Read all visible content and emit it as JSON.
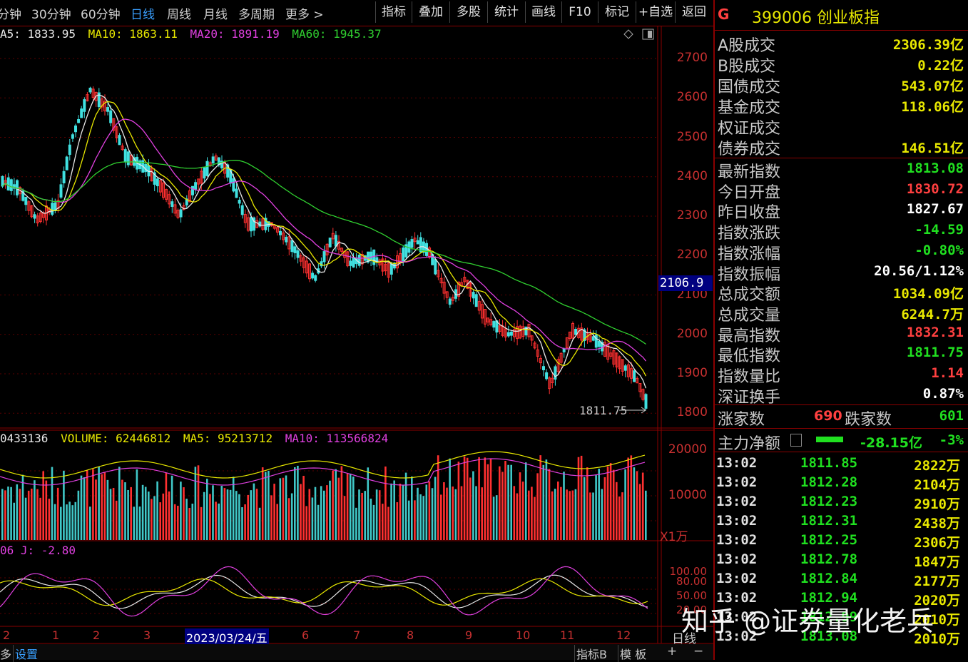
{
  "toolbar": {
    "periods": [
      "分钟",
      "30分钟",
      "60分钟",
      "日线",
      "周线",
      "月线",
      "多周期",
      "更多 >"
    ],
    "active_period": "日线",
    "buttons": [
      "指标",
      "叠加",
      "多股",
      "统计",
      "画线",
      "F10",
      "标记",
      "+自选",
      "返回"
    ]
  },
  "main_chart": {
    "ma_legend": [
      {
        "label": "A5: 1833.95",
        "color": "#e8e8e8"
      },
      {
        "label": "MA10: 1863.11",
        "color": "#e8e800"
      },
      {
        "label": "MA20: 1891.19",
        "color": "#e040e0"
      },
      {
        "label": "MA60: 1945.37",
        "color": "#30d030"
      }
    ],
    "y_ticks": [
      "2700",
      "2600",
      "2500",
      "2400",
      "2300",
      "2200",
      "2100",
      "2000",
      "1900",
      "1800"
    ],
    "cursor_price": "2106.9",
    "low_label": "1811.75"
  },
  "volume_panel": {
    "legend": [
      {
        "label": "0433136",
        "color": "#e8e8e8"
      },
      {
        "label": "VOLUME: 62446812",
        "color": "#e8e800"
      },
      {
        "label": "MA5: 95213712",
        "color": "#e8e800"
      },
      {
        "label": "MA10: 113566824",
        "color": "#e040e0"
      }
    ],
    "y_ticks": [
      "20000",
      "10000"
    ],
    "unit": "X1万"
  },
  "kdj_panel": {
    "legend": [
      {
        "label": "06  J: -2.80",
        "color": "#e040e0"
      }
    ],
    "y_ticks": [
      "100.00",
      "80.00",
      "50.00",
      "20.00"
    ]
  },
  "x_axis": {
    "labels": [
      "2",
      "1",
      "2",
      "3",
      "2023/03/24/五",
      "6",
      "7",
      "8",
      "9",
      "10",
      "11",
      "12"
    ],
    "right_label": "日线"
  },
  "bottom_bar": {
    "left_items": [
      "多",
      "设置"
    ],
    "right_items": [
      "指标B",
      "模 板",
      "+",
      "−"
    ]
  },
  "stock": {
    "badge": "G",
    "code": "399006",
    "name": "创业板指"
  },
  "turnover": [
    {
      "label": "A股成交",
      "value": "2306.39亿",
      "color": "#e8e800"
    },
    {
      "label": "B股成交",
      "value": "0.22亿",
      "color": "#e8e800"
    },
    {
      "label": "国债成交",
      "value": "543.07亿",
      "color": "#e8e800"
    },
    {
      "label": "基金成交",
      "value": "118.06亿",
      "color": "#e8e800"
    },
    {
      "label": "权证成交",
      "value": "",
      "color": "#e8e800"
    },
    {
      "label": "债券成交",
      "value": "146.51亿",
      "color": "#e8e800"
    }
  ],
  "quote": [
    {
      "label": "最新指数",
      "value": "1813.08",
      "color": "#20e020"
    },
    {
      "label": "今日开盘",
      "value": "1830.72",
      "color": "#ff4040"
    },
    {
      "label": "昨日收盘",
      "value": "1827.67",
      "color": "#ffffff"
    },
    {
      "label": "指数涨跌",
      "value": "-14.59",
      "color": "#20e020"
    },
    {
      "label": "指数涨幅",
      "value": "-0.80%",
      "color": "#20e020"
    },
    {
      "label": "指数振幅",
      "value": "20.56/1.12%",
      "color": "#ffffff"
    },
    {
      "label": "总成交额",
      "value": "1034.09亿",
      "color": "#e8e800"
    },
    {
      "label": "总成交量",
      "value": "6244.7万",
      "color": "#e8e800"
    },
    {
      "label": "最高指数",
      "value": "1832.31",
      "color": "#ff4040"
    },
    {
      "label": "最低指数",
      "value": "1811.75",
      "color": "#20e020"
    },
    {
      "label": "指数量比",
      "value": "1.14",
      "color": "#ff4040"
    },
    {
      "label": "深证换手",
      "value": "0.87%",
      "color": "#ffffff"
    }
  ],
  "breadth": {
    "up_label": "涨家数",
    "up": "690",
    "down_label": "跌家数",
    "down": "601"
  },
  "main_force": {
    "label": "主力净额",
    "value": "-28.15亿",
    "pct": "-3%"
  },
  "ticks": [
    {
      "time": "13:02",
      "price": "1811.85",
      "vol": "2822万"
    },
    {
      "time": "13:02",
      "price": "1812.28",
      "vol": "2104万"
    },
    {
      "time": "13:02",
      "price": "1812.23",
      "vol": "2910万"
    },
    {
      "time": "13:02",
      "price": "1812.31",
      "vol": "2438万"
    },
    {
      "time": "13:02",
      "price": "1812.25",
      "vol": "2306万"
    },
    {
      "time": "13:02",
      "price": "1812.78",
      "vol": "1847万"
    },
    {
      "time": "13:02",
      "price": "1812.84",
      "vol": "2177万"
    },
    {
      "time": "13:02",
      "price": "1812.94",
      "vol": "2020万"
    },
    {
      "time": "13:02",
      "price": "1812.99",
      "vol": "2010万"
    },
    {
      "time": "13:02",
      "price": "1813.08",
      "vol": "2010万"
    }
  ],
  "watermark": "知乎 @证券量化老兵"
}
